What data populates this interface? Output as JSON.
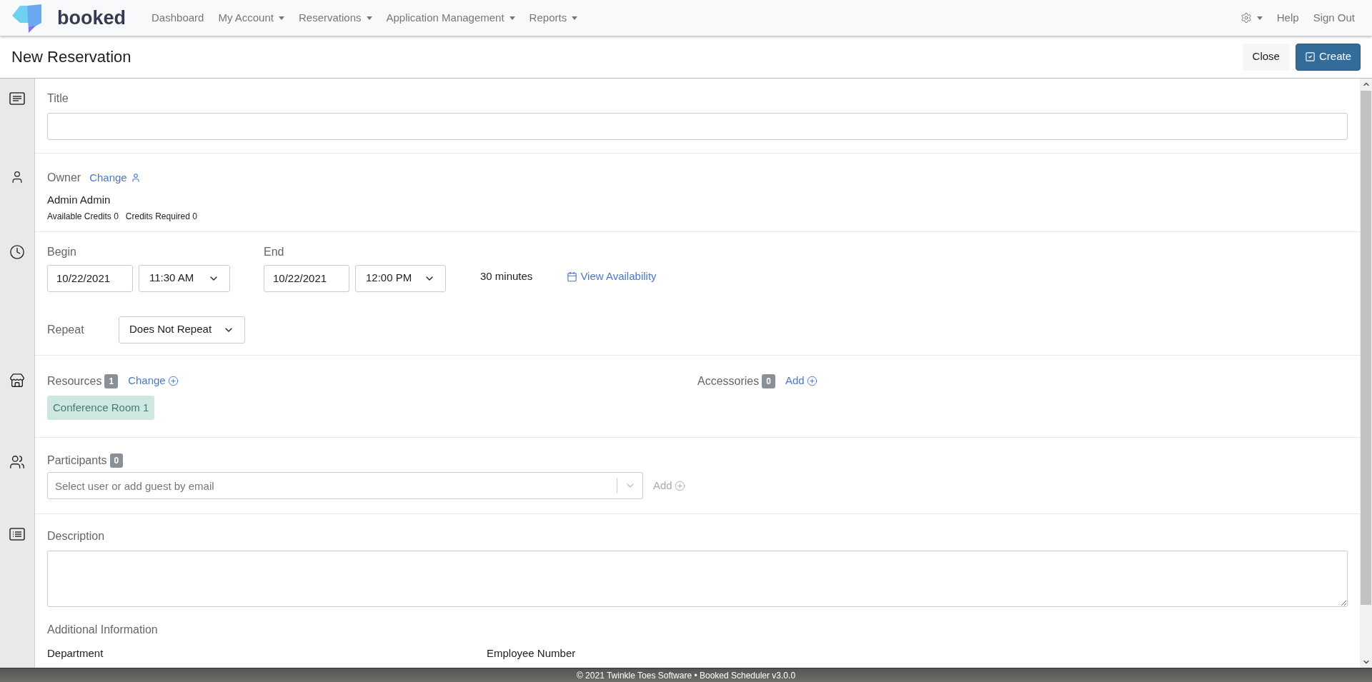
{
  "nav": {
    "brand": "booked",
    "items": [
      {
        "label": "Dashboard",
        "dropdown": false
      },
      {
        "label": "My Account",
        "dropdown": true
      },
      {
        "label": "Reservations",
        "dropdown": true
      },
      {
        "label": "Application Management",
        "dropdown": true
      },
      {
        "label": "Reports",
        "dropdown": true
      }
    ],
    "settings_dropdown": true,
    "links": [
      "Help",
      "Sign Out"
    ]
  },
  "page": {
    "title": "New Reservation",
    "buttons": [
      {
        "label": "Close",
        "kind": "secondary"
      },
      {
        "label": "Create",
        "kind": "primary"
      }
    ]
  },
  "title_section": {
    "label": "Title"
  },
  "owner": {
    "label": "Owner",
    "change_link": "Change",
    "name": "Admin Admin",
    "credits": [
      {
        "label": "Available Credits",
        "value": "0"
      },
      {
        "label": "Credits Required",
        "value": "0"
      }
    ]
  },
  "time": {
    "begin_label": "Begin",
    "begin_date": "10/22/2021",
    "begin_time": "11:30 AM",
    "end_label": "End",
    "end_date": "10/22/2021",
    "end_time": "12:00 PM",
    "duration": "30 minutes",
    "availability_link": "View Availability",
    "repeat_label": "Repeat",
    "repeat_value": "Does Not Repeat"
  },
  "resources": {
    "label": "Resources",
    "count": "1",
    "change_link": "Change",
    "items": [
      {
        "name": "Conference Room 1",
        "color": "#cfe7e1"
      }
    ],
    "accessories_label": "Accessories",
    "accessories_count": "0",
    "add_link": "Add"
  },
  "participants": {
    "label": "Participants",
    "count": "0",
    "placeholder": "Select user or add guest by email",
    "add_link": {
      "label": "Add",
      "disabled": true
    }
  },
  "description": {
    "label": "Description"
  },
  "additional": {
    "label": "Additional Information",
    "fields": [
      "Department",
      "Employee Number"
    ]
  },
  "footer": "© 2021 Twinkle Toes Software • Booked Scheduler v3.0.0"
}
